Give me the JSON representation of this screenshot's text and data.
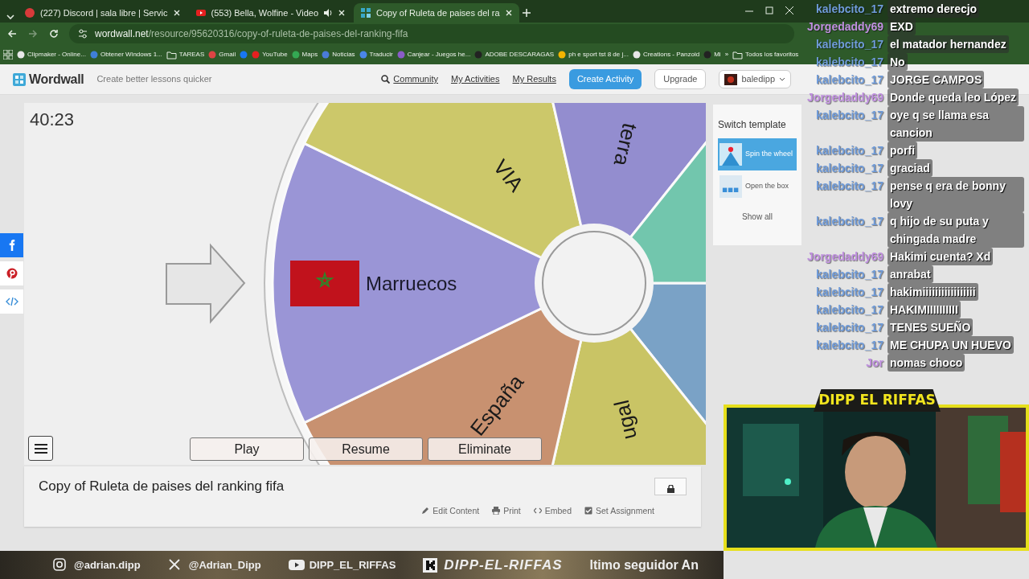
{
  "browser": {
    "tabs": [
      {
        "title": "(227) Discord | sala libre | Servic",
        "selected": false,
        "audible": false
      },
      {
        "title": "(553) Bella, Wolfine - Video",
        "selected": false,
        "audible": true
      },
      {
        "title": "Copy of Ruleta de paises del ra",
        "selected": true,
        "audible": false
      }
    ],
    "address": {
      "host": "wordwall.net",
      "path": "/resource/95620316/copy-of-ruleta-de-paises-del-ranking-fifa"
    },
    "bookmarks": [
      {
        "kind": "link",
        "label": "Clipmaker - Online..."
      },
      {
        "kind": "link",
        "label": "Obtener Windows 1..."
      },
      {
        "kind": "folder",
        "label": "TAREAS"
      },
      {
        "kind": "link",
        "label": "Gmail"
      },
      {
        "kind": "link"
      },
      {
        "kind": "link",
        "label": "YouTube"
      },
      {
        "kind": "link",
        "label": "Maps"
      },
      {
        "kind": "link",
        "label": "Noticias"
      },
      {
        "kind": "link",
        "label": "Traducir"
      },
      {
        "kind": "link",
        "label": "Canjear - Juegos he..."
      },
      {
        "kind": "link",
        "label": "ADOBE DESCARAGAS"
      },
      {
        "kind": "link",
        "label": "ph e sport tst 8 de j..."
      },
      {
        "kind": "link",
        "label": "Creations - Panzoid"
      },
      {
        "kind": "link",
        "label": "Mi"
      }
    ],
    "more": "»",
    "all_bookmarks": "Todos los favoritos"
  },
  "site": {
    "logo": "Wordwall",
    "tagline": "Create better lessons quicker",
    "nav": [
      "Community",
      "My Activities",
      "My Results"
    ],
    "create_button": "Create Activity",
    "upgrade_button": "Upgrade",
    "user": "baledipp"
  },
  "game": {
    "timer": "40:23",
    "wheel": {
      "segments": [
        {
          "color": "#7aa2c6"
        },
        {
          "label": "ugal",
          "color": "#c9c465",
          "flag": false
        },
        {
          "label": "España",
          "color": "#c89170",
          "flag": false
        },
        {
          "label": "Marruecos",
          "color": "#9a95d6",
          "flag": true
        },
        {
          "label": "VIA",
          "color": "#ccc86a",
          "flag": false
        },
        {
          "label": "terra",
          "color": "#938dcf",
          "flag": false
        },
        {
          "color": "#72c6ad"
        }
      ]
    },
    "buttons": [
      "Play",
      "Resume",
      "Eliminate"
    ]
  },
  "template_panel": {
    "title": "Switch template",
    "items": [
      {
        "label": "Spin the wheel",
        "selected": true
      },
      {
        "label": "Open the box",
        "selected": false
      }
    ],
    "show_all": "Show all"
  },
  "activity": {
    "title": "Copy of Ruleta de paises del ranking fifa",
    "actions": [
      "Edit Content",
      "Print",
      "Embed",
      "Set Assignment"
    ]
  },
  "chat": [
    {
      "user": "kalebcito_17",
      "color": "#6f9bd9",
      "message": "extremo derecjo"
    },
    {
      "user": "Jorgedaddy69",
      "color": "#c08fe0",
      "message": "EXD"
    },
    {
      "user": "kalebcito_17",
      "color": "#6f9bd9",
      "message": "el matador hernandez"
    },
    {
      "user": "kalebcito_17",
      "color": "#6f9bd9",
      "message": "No"
    },
    {
      "user": "kalebcito_17",
      "color": "#6f9bd9",
      "message": "JORGE CAMPOS"
    },
    {
      "user": "Jorgedaddy69",
      "color": "#c08fe0",
      "message": "Donde queda leo López"
    },
    {
      "user": "kalebcito_17",
      "color": "#6f9bd9",
      "message": "oye q se llama esa cancion"
    },
    {
      "user": "kalebcito_17",
      "color": "#6f9bd9",
      "message": "porfi"
    },
    {
      "user": "kalebcito_17",
      "color": "#6f9bd9",
      "message": "graciad"
    },
    {
      "user": "kalebcito_17",
      "color": "#6f9bd9",
      "message": "pense q era de bonny lovy"
    },
    {
      "user": "kalebcito_17",
      "color": "#6f9bd9",
      "message": "q hijo de su puta y chingada madre"
    },
    {
      "user": "Jorgedaddy69",
      "color": "#c08fe0",
      "message": "Hakimi cuenta? Xd"
    },
    {
      "user": "kalebcito_17",
      "color": "#6f9bd9",
      "message": "anrabat"
    },
    {
      "user": "kalebcito_17",
      "color": "#6f9bd9",
      "message": "hakimiiiiiiiiiiiiiiiii"
    },
    {
      "user": "kalebcito_17",
      "color": "#6f9bd9",
      "message": "HAKIMIIIIIIIIII"
    },
    {
      "user": "kalebcito_17",
      "color": "#6f9bd9",
      "message": "TENES SUEÑO"
    },
    {
      "user": "kalebcito_17",
      "color": "#6f9bd9",
      "message": "ME CHUPA UN HUEVO"
    },
    {
      "user": "Jor",
      "color": "#c08fe0",
      "message": "nomas choco"
    }
  ],
  "webcam": {
    "banner": "DIPP EL RIFFAS"
  },
  "stream_bar": {
    "items": [
      {
        "kind": "instagram",
        "label": "@adrian.dipp"
      },
      {
        "kind": "x",
        "label": "@Adrian_Dipp"
      },
      {
        "kind": "youtube",
        "label": "DIPP_EL_RIFFAS"
      },
      {
        "kind": "kick",
        "label": "DIPP-EL-RIFFAS"
      }
    ],
    "ticker": "ltimo seguidor An"
  }
}
